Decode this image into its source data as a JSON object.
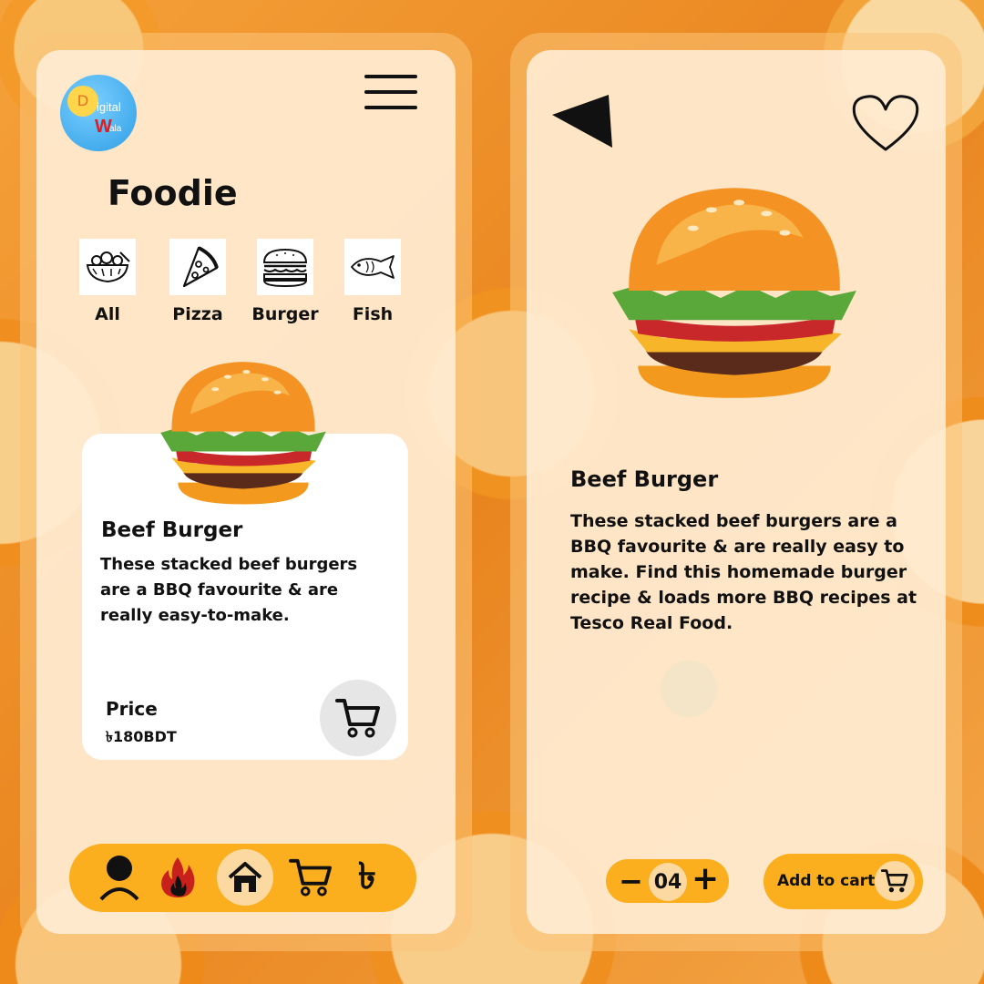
{
  "logo": {
    "letter": "D",
    "line1": "igital",
    "line2": "W",
    "line3": "ala"
  },
  "left_screen": {
    "title": "Foodie",
    "categories": [
      {
        "label": "All",
        "icon": "salad-bowl-icon"
      },
      {
        "label": "Pizza",
        "icon": "pizza-slice-icon"
      },
      {
        "label": "Burger",
        "icon": "burger-icon"
      },
      {
        "label": "Fish",
        "icon": "fish-icon"
      }
    ],
    "card": {
      "title": "Beef Burger",
      "description": "These stacked beef burgers are a BBQ favourite & are really easy-to-make.",
      "price_label": "Price",
      "price": "৳180BDT"
    },
    "nav": [
      "profile-icon",
      "fire-icon",
      "home-icon",
      "cart-icon",
      "taka-icon"
    ],
    "nav_taka": "৳"
  },
  "right_screen": {
    "title": "Beef Burger",
    "description": "These stacked beef burgers are a BBQ favourite & are really easy to make. Find this homemade burger recipe & loads more BBQ recipes at Tesco Real Food.",
    "quantity": "04",
    "add_to_cart_label": "Add to cart"
  },
  "colors": {
    "accent": "#fbae1e",
    "panel": "#ffefda",
    "text": "#111111"
  }
}
